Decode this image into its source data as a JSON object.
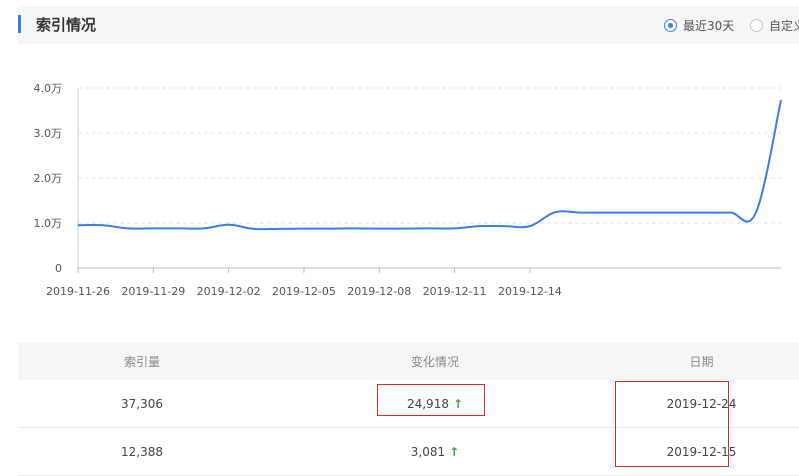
{
  "header": {
    "title": "索引情况",
    "range_options": [
      {
        "label": "最近30天",
        "selected": true
      },
      {
        "label": "自定义",
        "selected": false
      }
    ]
  },
  "chart_data": {
    "type": "line",
    "title": "",
    "xlabel": "",
    "ylabel": "",
    "x_ticks": [
      "2019-11-26",
      "2019-11-29",
      "2019-12-02",
      "2019-12-05",
      "2019-12-08",
      "2019-12-11",
      "2019-12-14"
    ],
    "y_ticks": [
      "0",
      "1.0万",
      "2.0万",
      "3.0万",
      "4.0万"
    ],
    "ylim": [
      0,
      40000
    ],
    "x_range": [
      "2019-11-26",
      "2019-12-24"
    ],
    "grid": true,
    "line_color": "#3b7ee6",
    "series": [
      {
        "x": [
          "2019-11-26",
          "2019-11-27",
          "2019-11-28",
          "2019-11-29",
          "2019-11-30",
          "2019-12-01",
          "2019-12-02",
          "2019-12-03",
          "2019-12-04",
          "2019-12-05",
          "2019-12-06",
          "2019-12-07",
          "2019-12-08",
          "2019-12-09",
          "2019-12-10",
          "2019-12-11",
          "2019-12-12",
          "2019-12-13",
          "2019-12-14",
          "2019-12-15",
          "2019-12-16",
          "2019-12-17",
          "2019-12-18",
          "2019-12-19",
          "2019-12-20",
          "2019-12-21",
          "2019-12-22",
          "2019-12-23",
          "2019-12-24"
        ],
        "values": [
          9500,
          9500,
          8800,
          8800,
          8800,
          8800,
          9600,
          8700,
          8700,
          8750,
          8750,
          8800,
          8750,
          8750,
          8800,
          8800,
          9300,
          9300,
          9300,
          12388,
          12300,
          12300,
          12300,
          12300,
          12300,
          12300,
          12300,
          12300,
          37306
        ]
      }
    ]
  },
  "table": {
    "headers": [
      "索引量",
      "变化情况",
      "日期"
    ],
    "rows": [
      {
        "count": "37,306",
        "change": "24,918",
        "trend": "↑",
        "date": "2019-12-24"
      },
      {
        "count": "12,388",
        "change": "3,081",
        "trend": "↑",
        "date": "2019-12-15"
      }
    ]
  },
  "colors": {
    "accent": "#3b7ee6",
    "up": "#3aa24b",
    "highlight": "#e02a2a"
  }
}
